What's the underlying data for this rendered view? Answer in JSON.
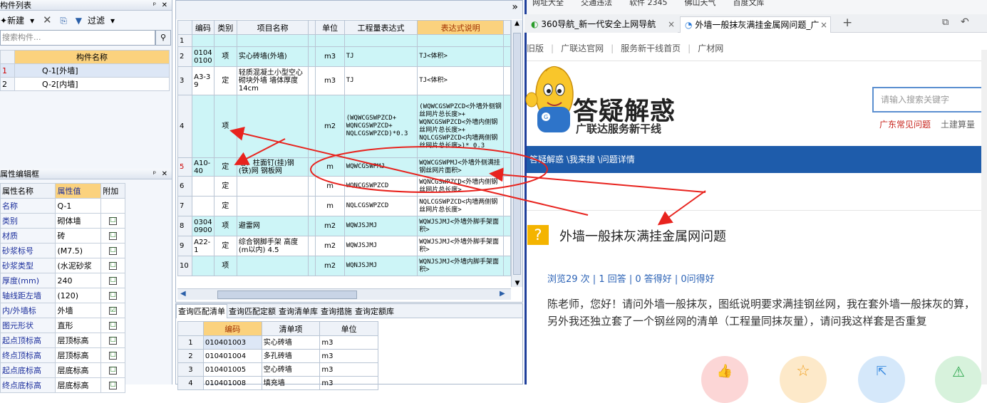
{
  "left_panel": {
    "title": "构件列表",
    "pin": "ᵖ",
    "close": "×",
    "toolbar": {
      "new": "新建",
      "delete": "✕",
      "copy": "⎘",
      "filter": "过滤"
    },
    "search_placeholder": "搜索构件...",
    "col_header": "构件名称",
    "components": [
      {
        "no": "1",
        "name": "Q-1[外墙]"
      },
      {
        "no": "2",
        "name": "Q-2[内墙]"
      }
    ]
  },
  "props_panel": {
    "title": "属性编辑框",
    "headers": [
      "属性名称",
      "属性值",
      "附加"
    ],
    "rows": [
      {
        "name": "名称",
        "value": "Q-1",
        "check": ""
      },
      {
        "name": "类别",
        "value": "砌体墙",
        "check": "☐"
      },
      {
        "name": "材质",
        "value": "砖",
        "check": "☐"
      },
      {
        "name": "砂浆标号",
        "value": "(M7.5)",
        "check": "☐"
      },
      {
        "name": "砂浆类型",
        "value": "(水泥砂浆",
        "check": "☐"
      },
      {
        "name": "厚度(mm)",
        "value": "240",
        "check": "☐"
      },
      {
        "name": "轴线距左墙",
        "value": "(120)",
        "check": "☐"
      },
      {
        "name": "内/外墙标",
        "value": "外墙",
        "check": "☑"
      },
      {
        "name": "图元形状",
        "value": "直形",
        "check": "☐"
      },
      {
        "name": "起点顶标高",
        "value": "层顶标高",
        "check": "☐"
      },
      {
        "name": "终点顶标高",
        "value": "层顶标高",
        "check": "☐"
      },
      {
        "name": "起点底标高",
        "value": "层底标高",
        "check": "☐"
      },
      {
        "name": "终点底标高",
        "value": "层底标高",
        "check": "☐"
      }
    ]
  },
  "main_grid": {
    "headers": [
      "编码",
      "类别",
      "项目名称",
      "单位",
      "工程量表达式",
      "表达式说明"
    ],
    "rows": [
      {
        "no": "1",
        "code": "",
        "type": "",
        "name": "",
        "unit": "",
        "expr": "",
        "desc": ""
      },
      {
        "no": "2",
        "code": "0104 0100",
        "type": "项",
        "name": "实心砖墙(外墙)",
        "unit": "m3",
        "expr": "TJ",
        "desc": "TJ<体积>"
      },
      {
        "no": "3",
        "code": "A3-3 9",
        "type": "定",
        "name": "轻质混凝土小型空心砌块外墙 墙体厚度 14cm",
        "unit": "m3",
        "expr": "TJ",
        "desc": "TJ<体积>"
      },
      {
        "no": "4",
        "code": "",
        "type": "项",
        "name": "",
        "unit": "m2",
        "expr": "(WQWCGSWPZCD+ WQNCGSWPZCD+ NQLCGSWPZCD)*0.3",
        "desc": "(WQWCGSWPZCD<外墙外侧钢丝网片总长度>+ WQNCGSWPZCD<外墙内侧钢丝网片总长度>+ NQLCGSWPZCD<内墙两侧钢丝网片总长度>)* 0.3"
      },
      {
        "no": "5",
        "code": "A10- 40",
        "type": "定",
        "name": "墙、柱面钉(挂)钢(铁)网 钢板网",
        "unit": "m",
        "expr": "WQWCGSWPMJ",
        "desc": "WQWCGSWPMJ<外墙外侧满挂钢丝网片面积>"
      },
      {
        "no": "6",
        "code": "",
        "type": "定",
        "name": "",
        "unit": "m",
        "expr": "WQNCGSWPZCD",
        "desc": "WQNCGSWPZCD<外墙内侧钢丝网片总长度>"
      },
      {
        "no": "7",
        "code": "",
        "type": "定",
        "name": "",
        "unit": "m",
        "expr": "NQLCGSWPZCD",
        "desc": "NQLCGSWPZCD<内墙两侧钢丝网片总长度>"
      },
      {
        "no": "8",
        "code": "0304 0900",
        "type": "项",
        "name": "避雷网",
        "unit": "m2",
        "expr": "WQWJSJMJ",
        "desc": "WQWJSJMJ<外墙外脚手架面积>"
      },
      {
        "no": "9",
        "code": "A22- 1",
        "type": "定",
        "name": "综合钢脚手架 高度(m以内) 4.5",
        "unit": "m2",
        "expr": "WQWJSJMJ",
        "desc": "WQWJSJMJ<外墙外脚手架面积>"
      },
      {
        "no": "10",
        "code": "",
        "type": "项",
        "name": "",
        "unit": "m2",
        "expr": "WQNJSJMJ",
        "desc": "WQNJSJMJ<外墙内脚手架面积>"
      }
    ]
  },
  "bottom_tabs": [
    "查询匹配清单",
    "查询匹配定额",
    "查询清单库",
    "查询措施",
    "查询定额库"
  ],
  "bottom_grid": {
    "headers": [
      "编码",
      "清单项",
      "单位"
    ],
    "rows": [
      {
        "no": "1",
        "code": "010401003",
        "item": "实心砖墙",
        "unit": "m3"
      },
      {
        "no": "2",
        "code": "010401004",
        "item": "多孔砖墙",
        "unit": "m3"
      },
      {
        "no": "3",
        "code": "010401005",
        "item": "空心砖墙",
        "unit": "m3"
      },
      {
        "no": "4",
        "code": "010401008",
        "item": "填充墙",
        "unit": "m3"
      }
    ]
  },
  "browser": {
    "bookmarks": [
      "网址大全",
      "交通违法",
      "软件 2345",
      "佛山天气",
      "百度文库"
    ],
    "tabs": [
      {
        "label": "360导航_新一代安全上网导航"
      },
      {
        "label": "外墙一般抹灰满挂金属网问题_广"
      }
    ],
    "site_links": [
      "旧版",
      "广联达官网",
      "服务新干线首页",
      "广材网"
    ],
    "logo_title": "答疑解惑",
    "logo_sub": "广联达服务新干线",
    "search_placeholder": "请输入搜索关键字",
    "hot_links": [
      "广东常见问题",
      "土建算量"
    ],
    "breadcrumb": "答疑解惑 \\我来搜 \\问题详情",
    "question_title": "外墙一般抹灰满挂金属网问题",
    "stats": "浏览29 次 | 1 回答 | 0 答得好 | 0问得好",
    "body": "陈老师，您好！请问外墙一般抹灰，图纸说明要求满挂钢丝网，我在套外墙一般抹灰的算，另外我还独立套了一个钢丝网的清单（工程量同抹灰量），请问我这样套是否重复"
  },
  "colors": {
    "arrow": "#e8231e",
    "bar": "#1e5cab",
    "header_orange": "#fbd27e",
    "row_cyan": "#cdf5f7"
  }
}
